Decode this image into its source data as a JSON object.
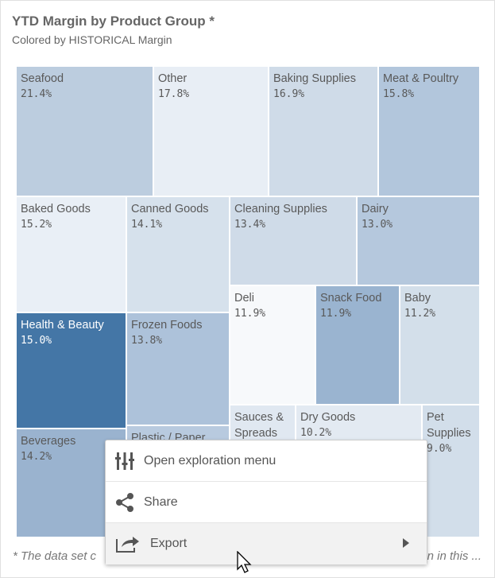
{
  "chart_data": {
    "type": "treemap",
    "title": "YTD Margin by Product Group *",
    "subtitle": "Colored by HISTORICAL Margin",
    "items": [
      {
        "name": "Seafood",
        "value": "21.4%",
        "color": "#bccddf"
      },
      {
        "name": "Other",
        "value": "17.8%",
        "color": "#e8eef5"
      },
      {
        "name": "Baking Supplies",
        "value": "16.9%",
        "color": "#cfdbe8"
      },
      {
        "name": "Meat & Poultry",
        "value": "15.8%",
        "color": "#b2c6dc"
      },
      {
        "name": "Baked Goods",
        "value": "15.2%",
        "color": "#e9eff6"
      },
      {
        "name": "Canned Goods",
        "value": "14.1%",
        "color": "#d6e1ec"
      },
      {
        "name": "Cleaning Supplies",
        "value": "13.4%",
        "color": "#cfdbe8"
      },
      {
        "name": "Dairy",
        "value": "13.0%",
        "color": "#b5c8dd"
      },
      {
        "name": "Health & Beauty",
        "value": "15.0%",
        "color": "#4476a6"
      },
      {
        "name": "Beverages",
        "value": "14.2%",
        "color": "#9ab3cf"
      },
      {
        "name": "Frozen Foods",
        "value": "13.8%",
        "color": "#adc2da"
      },
      {
        "name": "Plastic / Paper",
        "value": "",
        "color": "#b8cadf"
      },
      {
        "name": "Deli",
        "value": "11.9%",
        "color": "#f7f9fb"
      },
      {
        "name": "Snack Food",
        "value": "11.9%",
        "color": "#9ab4d0"
      },
      {
        "name": "Baby",
        "value": "11.2%",
        "color": "#d3dfea"
      },
      {
        "name": "Sauces & Spreads",
        "value": "",
        "color": "#e0e8f1"
      },
      {
        "name": "Dry Goods",
        "value": "10.2%",
        "color": "#e3eaf2"
      },
      {
        "name": "Pet Supplies",
        "value": "9.0%",
        "color": "#d2deea"
      }
    ]
  },
  "footnote": {
    "left": "* The data set c",
    "right": "n in this ..."
  },
  "menu": {
    "items": [
      {
        "label": "Open exploration menu",
        "icon": "sliders-icon"
      },
      {
        "label": "Share",
        "icon": "share-icon"
      },
      {
        "label": "Export",
        "icon": "export-icon",
        "submenu": true
      }
    ]
  }
}
